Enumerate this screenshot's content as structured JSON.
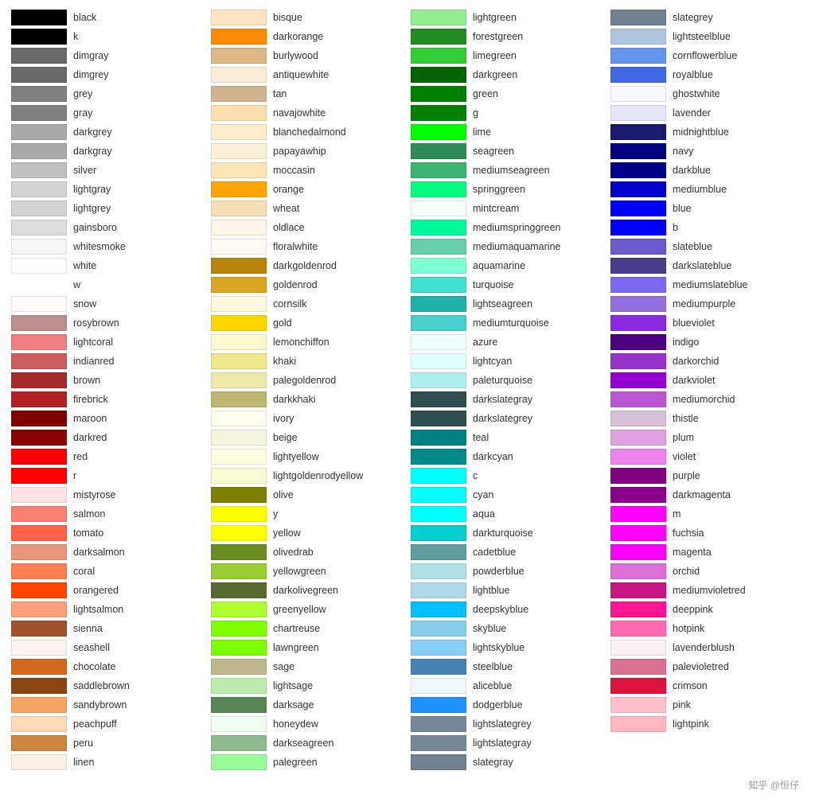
{
  "columns": [
    {
      "items": [
        {
          "name": "black",
          "color": "#000000"
        },
        {
          "name": "k",
          "color": "#000000"
        },
        {
          "name": "dimgray",
          "color": "#696969"
        },
        {
          "name": "dimgrey",
          "color": "#696969"
        },
        {
          "name": "grey",
          "color": "#808080"
        },
        {
          "name": "gray",
          "color": "#808080"
        },
        {
          "name": "darkgrey",
          "color": "#a9a9a9"
        },
        {
          "name": "darkgray",
          "color": "#a9a9a9"
        },
        {
          "name": "silver",
          "color": "#c0c0c0"
        },
        {
          "name": "lightgray",
          "color": "#d3d3d3"
        },
        {
          "name": "lightgrey",
          "color": "#d3d3d3"
        },
        {
          "name": "gainsboro",
          "color": "#dcdcdc"
        },
        {
          "name": "whitesmoke",
          "color": "#f5f5f5"
        },
        {
          "name": "white",
          "color": "#ffffff"
        },
        {
          "name": "w",
          "color": "none"
        },
        {
          "name": "snow",
          "color": "#fffafa"
        },
        {
          "name": "rosybrown",
          "color": "#bc8f8f"
        },
        {
          "name": "lightcoral",
          "color": "#f08080"
        },
        {
          "name": "indianred",
          "color": "#cd5c5c"
        },
        {
          "name": "brown",
          "color": "#a52a2a"
        },
        {
          "name": "firebrick",
          "color": "#b22222"
        },
        {
          "name": "maroon",
          "color": "#800000"
        },
        {
          "name": "darkred",
          "color": "#8b0000"
        },
        {
          "name": "red",
          "color": "#ff0000"
        },
        {
          "name": "r",
          "color": "#ff0000"
        },
        {
          "name": "mistyrose",
          "color": "#ffe4e1"
        },
        {
          "name": "salmon",
          "color": "#fa8072"
        },
        {
          "name": "tomato",
          "color": "#ff6347"
        },
        {
          "name": "darksalmon",
          "color": "#e9967a"
        },
        {
          "name": "coral",
          "color": "#ff7f50"
        },
        {
          "name": "orangered",
          "color": "#ff4500"
        },
        {
          "name": "lightsalmon",
          "color": "#ffa07a"
        },
        {
          "name": "sienna",
          "color": "#a0522d"
        },
        {
          "name": "seashell",
          "color": "#fff5ee"
        },
        {
          "name": "chocolate",
          "color": "#d2691e"
        },
        {
          "name": "saddlebrown",
          "color": "#8b4513"
        },
        {
          "name": "sandybrown",
          "color": "#f4a460"
        },
        {
          "name": "peachpuff",
          "color": "#ffdab9"
        },
        {
          "name": "peru",
          "color": "#cd853f"
        },
        {
          "name": "linen",
          "color": "#faf0e6"
        }
      ]
    },
    {
      "items": [
        {
          "name": "bisque",
          "color": "#ffe4c4"
        },
        {
          "name": "darkorange",
          "color": "#ff8c00"
        },
        {
          "name": "burlywood",
          "color": "#deb887"
        },
        {
          "name": "antiquewhite",
          "color": "#faebd7"
        },
        {
          "name": "tan",
          "color": "#d2b48c"
        },
        {
          "name": "navajowhite",
          "color": "#ffdead"
        },
        {
          "name": "blanchedalmond",
          "color": "#ffebcd"
        },
        {
          "name": "papayawhip",
          "color": "#ffefd5"
        },
        {
          "name": "moccasin",
          "color": "#ffe4b5"
        },
        {
          "name": "orange",
          "color": "#ffa500"
        },
        {
          "name": "wheat",
          "color": "#f5deb3"
        },
        {
          "name": "oldlace",
          "color": "#fdf5e6"
        },
        {
          "name": "floralwhite",
          "color": "#fffaf0"
        },
        {
          "name": "darkgoldenrod",
          "color": "#b8860b"
        },
        {
          "name": "goldenrod",
          "color": "#daa520"
        },
        {
          "name": "cornsilk",
          "color": "#fff8dc"
        },
        {
          "name": "gold",
          "color": "#ffd700"
        },
        {
          "name": "lemonchiffon",
          "color": "#fffacd"
        },
        {
          "name": "khaki",
          "color": "#f0e68c"
        },
        {
          "name": "palegoldenrod",
          "color": "#eee8aa"
        },
        {
          "name": "darkkhaki",
          "color": "#bdb76b"
        },
        {
          "name": "ivory",
          "color": "#fffff0"
        },
        {
          "name": "beige",
          "color": "#f5f5dc"
        },
        {
          "name": "lightyellow",
          "color": "#ffffe0"
        },
        {
          "name": "lightgoldenrodyellow",
          "color": "#fafad2"
        },
        {
          "name": "olive",
          "color": "#808000"
        },
        {
          "name": "y",
          "color": "#ffff00"
        },
        {
          "name": "yellow",
          "color": "#ffff00"
        },
        {
          "name": "olivedrab",
          "color": "#6b8e23"
        },
        {
          "name": "yellowgreen",
          "color": "#9acd32"
        },
        {
          "name": "darkolivegreen",
          "color": "#556b2f"
        },
        {
          "name": "greenyellow",
          "color": "#adff2f"
        },
        {
          "name": "chartreuse",
          "color": "#7fff00"
        },
        {
          "name": "lawngreen",
          "color": "#7cfc00"
        },
        {
          "name": "sage",
          "color": "#bcb88a"
        },
        {
          "name": "lightsage",
          "color": "#bcecac"
        },
        {
          "name": "darksage",
          "color": "#598556"
        },
        {
          "name": "honeydew",
          "color": "#f0fff0"
        },
        {
          "name": "darkseagreen",
          "color": "#8fbc8f"
        },
        {
          "name": "palegreen",
          "color": "#98fb98"
        }
      ]
    },
    {
      "items": [
        {
          "name": "lightgreen",
          "color": "#90ee90"
        },
        {
          "name": "forestgreen",
          "color": "#228b22"
        },
        {
          "name": "limegreen",
          "color": "#32cd32"
        },
        {
          "name": "darkgreen",
          "color": "#006400"
        },
        {
          "name": "green",
          "color": "#008000"
        },
        {
          "name": "g",
          "color": "#008000"
        },
        {
          "name": "lime",
          "color": "#00ff00"
        },
        {
          "name": "seagreen",
          "color": "#2e8b57"
        },
        {
          "name": "mediumseagreen",
          "color": "#3cb371"
        },
        {
          "name": "springgreen",
          "color": "#00ff7f"
        },
        {
          "name": "mintcream",
          "color": "#f5fffa"
        },
        {
          "name": "mediumspringgreen",
          "color": "#00fa9a"
        },
        {
          "name": "mediumaquamarine",
          "color": "#66cdaa"
        },
        {
          "name": "aquamarine",
          "color": "#7fffd4"
        },
        {
          "name": "turquoise",
          "color": "#40e0d0"
        },
        {
          "name": "lightseagreen",
          "color": "#20b2aa"
        },
        {
          "name": "mediumturquoise",
          "color": "#48d1cc"
        },
        {
          "name": "azure",
          "color": "#f0ffff"
        },
        {
          "name": "lightcyan",
          "color": "#e0ffff"
        },
        {
          "name": "paleturquoise",
          "color": "#afeeee"
        },
        {
          "name": "darkslategray",
          "color": "#2f4f4f"
        },
        {
          "name": "darkslategrey",
          "color": "#2f4f4f"
        },
        {
          "name": "teal",
          "color": "#008080"
        },
        {
          "name": "darkcyan",
          "color": "#008b8b"
        },
        {
          "name": "c",
          "color": "#00ffff"
        },
        {
          "name": "cyan",
          "color": "#00ffff"
        },
        {
          "name": "aqua",
          "color": "#00ffff"
        },
        {
          "name": "darkturquoise",
          "color": "#00ced1"
        },
        {
          "name": "cadetblue",
          "color": "#5f9ea0"
        },
        {
          "name": "powderblue",
          "color": "#b0e0e6"
        },
        {
          "name": "lightblue",
          "color": "#add8e6"
        },
        {
          "name": "deepskyblue",
          "color": "#00bfff"
        },
        {
          "name": "skyblue",
          "color": "#87ceeb"
        },
        {
          "name": "lightskyblue",
          "color": "#87cefa"
        },
        {
          "name": "steelblue",
          "color": "#4682b4"
        },
        {
          "name": "aliceblue",
          "color": "#f0f8ff"
        },
        {
          "name": "dodgerblue",
          "color": "#1e90ff"
        },
        {
          "name": "lightslategrey",
          "color": "#778899"
        },
        {
          "name": "lightslategray",
          "color": "#778899"
        },
        {
          "name": "slategray",
          "color": "#708090"
        }
      ]
    },
    {
      "items": [
        {
          "name": "slategrey",
          "color": "#708090"
        },
        {
          "name": "lightsteelblue",
          "color": "#b0c4de"
        },
        {
          "name": "cornflowerblue",
          "color": "#6495ed"
        },
        {
          "name": "royalblue",
          "color": "#4169e1"
        },
        {
          "name": "ghostwhite",
          "color": "#f8f8ff"
        },
        {
          "name": "lavender",
          "color": "#e6e6fa"
        },
        {
          "name": "midnightblue",
          "color": "#191970"
        },
        {
          "name": "navy",
          "color": "#000080"
        },
        {
          "name": "darkblue",
          "color": "#00008b"
        },
        {
          "name": "mediumblue",
          "color": "#0000cd"
        },
        {
          "name": "blue",
          "color": "#0000ff"
        },
        {
          "name": "b",
          "color": "#0000ff"
        },
        {
          "name": "slateblue",
          "color": "#6a5acd"
        },
        {
          "name": "darkslateblue",
          "color": "#483d8b"
        },
        {
          "name": "mediumslateblue",
          "color": "#7b68ee"
        },
        {
          "name": "mediumpurple",
          "color": "#9370db"
        },
        {
          "name": "blueviolet",
          "color": "#8a2be2"
        },
        {
          "name": "indigo",
          "color": "#4b0082"
        },
        {
          "name": "darkorchid",
          "color": "#9932cc"
        },
        {
          "name": "darkviolet",
          "color": "#9400d3"
        },
        {
          "name": "mediumorchid",
          "color": "#ba55d3"
        },
        {
          "name": "thistle",
          "color": "#d8bfd8"
        },
        {
          "name": "plum",
          "color": "#dda0dd"
        },
        {
          "name": "violet",
          "color": "#ee82ee"
        },
        {
          "name": "purple",
          "color": "#800080"
        },
        {
          "name": "darkmagenta",
          "color": "#8b008b"
        },
        {
          "name": "m",
          "color": "#ff00ff"
        },
        {
          "name": "fuchsia",
          "color": "#ff00ff"
        },
        {
          "name": "magenta",
          "color": "#ff00ff"
        },
        {
          "name": "orchid",
          "color": "#da70d6"
        },
        {
          "name": "mediumvioletred",
          "color": "#c71585"
        },
        {
          "name": "deeppink",
          "color": "#ff1493"
        },
        {
          "name": "hotpink",
          "color": "#ff69b4"
        },
        {
          "name": "lavenderblush",
          "color": "#fff0f5"
        },
        {
          "name": "palevioletred",
          "color": "#db7093"
        },
        {
          "name": "crimson",
          "color": "#dc143c"
        },
        {
          "name": "pink",
          "color": "#ffc0cb"
        },
        {
          "name": "lightpink",
          "color": "#ffb6c1"
        }
      ]
    }
  ],
  "watermark": "知乎 @恒仔"
}
